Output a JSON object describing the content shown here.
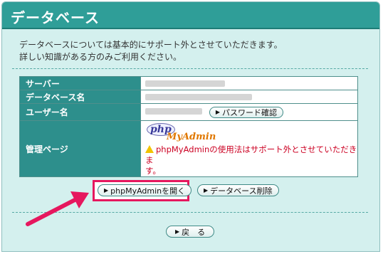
{
  "section": {
    "title": "データベース",
    "description_line1": "データベースについては基本的にサポート外とさせていただきます。",
    "description_line2": "詳しい知識がある方のみご利用ください。"
  },
  "table": {
    "server_label": "サーバー",
    "dbname_label": "データベース名",
    "username_label": "ユーザー名",
    "admin_label": "管理ページ",
    "password_button": "パスワード確認",
    "logo_php": "php",
    "logo_myadmin": "MyAdmin",
    "warning_line1": "phpMyAdminの使用法はサポート外とさせていただきま",
    "warning_line2": "す。"
  },
  "actions": {
    "open_phpmyadmin": "phpMyAdminを開く",
    "delete_database": "データベース削除",
    "back": "戻　る"
  },
  "colors": {
    "header": "#2f9e98",
    "panel": "#d4f0ee",
    "label_cell": "#2d8f8c",
    "highlight": "#e6175e",
    "warning_text": "#cc0022"
  }
}
